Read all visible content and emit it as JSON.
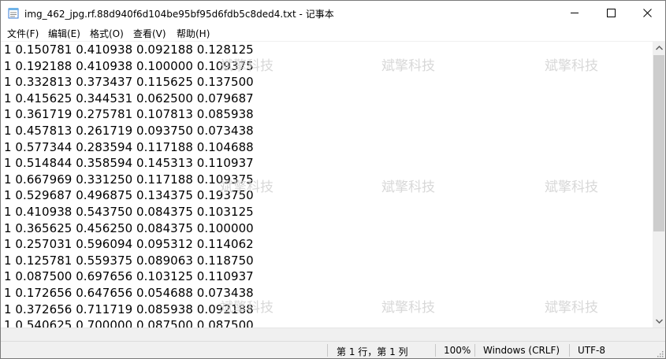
{
  "window": {
    "title": "img_462_jpg.rf.88d940f6d104be95bf95d6fdb5c8ded4.txt - 记事本"
  },
  "menu": [
    {
      "label": "文件(F)"
    },
    {
      "label": "编辑(E)"
    },
    {
      "label": "格式(O)"
    },
    {
      "label": "查看(V)"
    },
    {
      "label": "帮助(H)"
    }
  ],
  "lines": [
    "1 0.150781 0.410938 0.092188 0.128125",
    "1 0.192188 0.410938 0.100000 0.109375",
    "1 0.332813 0.373437 0.115625 0.137500",
    "1 0.415625 0.344531 0.062500 0.079687",
    "1 0.361719 0.275781 0.107813 0.085938",
    "1 0.457813 0.261719 0.093750 0.073438",
    "1 0.577344 0.283594 0.117188 0.104688",
    "1 0.514844 0.358594 0.145313 0.110937",
    "1 0.667969 0.331250 0.117188 0.109375",
    "1 0.529687 0.496875 0.134375 0.193750",
    "1 0.410938 0.543750 0.084375 0.103125",
    "1 0.365625 0.456250 0.084375 0.100000",
    "1 0.257031 0.596094 0.095312 0.114062",
    "1 0.125781 0.559375 0.089063 0.118750",
    "1 0.087500 0.697656 0.103125 0.110937",
    "1 0.172656 0.647656 0.054688 0.073438",
    "1 0.372656 0.711719 0.085938 0.092188",
    "1 0.540625 0.700000 0.087500 0.087500"
  ],
  "watermark": "斌擎科技",
  "status": {
    "position": "第 1 行，第 1 列",
    "zoom": "100%",
    "line_ending": "Windows (CRLF)",
    "encoding": "UTF-8"
  },
  "icons": {
    "app": "notepad-icon",
    "minimize": "minimize-icon",
    "maximize": "maximize-icon",
    "close": "close-icon",
    "scroll_up": "chevron-up-icon",
    "scroll_down": "chevron-down-icon"
  },
  "colors": {
    "window_bg": "#ffffff",
    "chrome_bg": "#f0f0f0",
    "scroll_thumb": "#cdcdcd",
    "watermark": "#d2d2d2"
  }
}
